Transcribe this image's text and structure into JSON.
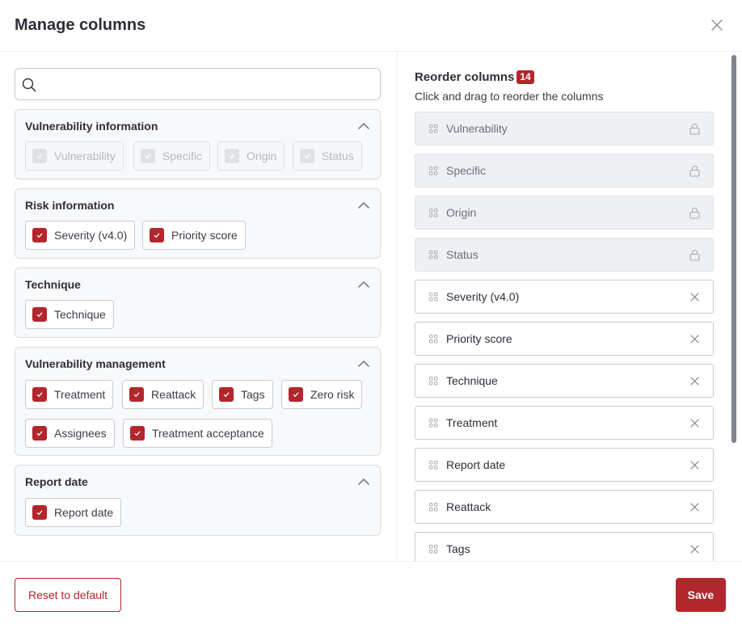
{
  "modal": {
    "title": "Manage columns",
    "close_icon": "close-icon"
  },
  "search": {
    "value": "",
    "placeholder": "",
    "icon": "search-icon"
  },
  "groups": [
    {
      "title": "Vulnerability information",
      "expanded": true,
      "items": [
        {
          "label": "Vulnerability",
          "checked": true,
          "disabled": true
        },
        {
          "label": "Specific",
          "checked": true,
          "disabled": true
        },
        {
          "label": "Origin",
          "checked": true,
          "disabled": true
        },
        {
          "label": "Status",
          "checked": true,
          "disabled": true
        }
      ]
    },
    {
      "title": "Risk information",
      "expanded": true,
      "items": [
        {
          "label": "Severity (v4.0)",
          "checked": true,
          "disabled": false
        },
        {
          "label": "Priority score",
          "checked": true,
          "disabled": false
        }
      ]
    },
    {
      "title": "Technique",
      "expanded": true,
      "items": [
        {
          "label": "Technique",
          "checked": true,
          "disabled": false
        }
      ]
    },
    {
      "title": "Vulnerability management",
      "expanded": true,
      "items": [
        {
          "label": "Treatment",
          "checked": true,
          "disabled": false
        },
        {
          "label": "Reattack",
          "checked": true,
          "disabled": false
        },
        {
          "label": "Tags",
          "checked": true,
          "disabled": false
        },
        {
          "label": "Zero risk",
          "checked": true,
          "disabled": false
        },
        {
          "label": "Assignees",
          "checked": true,
          "disabled": false
        },
        {
          "label": "Treatment acceptance",
          "checked": true,
          "disabled": false
        }
      ]
    },
    {
      "title": "Report date",
      "expanded": true,
      "items": [
        {
          "label": "Report date",
          "checked": true,
          "disabled": false
        }
      ]
    }
  ],
  "reorder": {
    "title": "Reorder columns",
    "count": "14",
    "subtitle": "Click and drag to reorder the columns",
    "columns": [
      {
        "label": "Vulnerability",
        "locked": true
      },
      {
        "label": "Specific",
        "locked": true
      },
      {
        "label": "Origin",
        "locked": true
      },
      {
        "label": "Status",
        "locked": true
      },
      {
        "label": "Severity (v4.0)",
        "locked": false
      },
      {
        "label": "Priority score",
        "locked": false
      },
      {
        "label": "Technique",
        "locked": false
      },
      {
        "label": "Treatment",
        "locked": false
      },
      {
        "label": "Report date",
        "locked": false
      },
      {
        "label": "Reattack",
        "locked": false
      },
      {
        "label": "Tags",
        "locked": false
      }
    ]
  },
  "footer": {
    "reset_label": "Reset to default",
    "save_label": "Save"
  },
  "colors": {
    "accent": "#b3262b",
    "disabled": "#dfe1e6",
    "border": "#c8cbd2"
  }
}
